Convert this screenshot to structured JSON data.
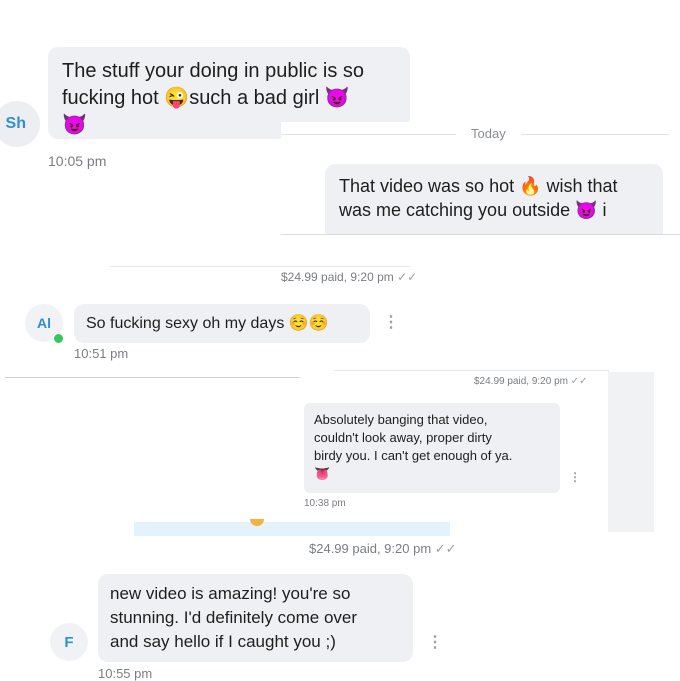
{
  "chat1": {
    "avatar": "Sh",
    "message": "The stuff your doing in public is so\nfucking hot 😜such a bad girl 😈\n😈",
    "time": "10:05 pm",
    "divider_label": "Today",
    "outgoing": "That video was so hot 🔥 wish that\nwas me catching you outside 😈 i",
    "paid": "$24.99 paid, 9:20 pm"
  },
  "chat2": {
    "avatar": "Al",
    "online_color": "#34c759",
    "message": "So fucking sexy oh my days ☺️☺️",
    "time": "10:51 pm",
    "paid_top": "$24.99 paid, 9:20 pm",
    "reply": "Absolutely banging that video,\ncouldn't look away, proper dirty\nbirdy you. I can't get enough of ya.\n👅",
    "reply_time": "10:38 pm",
    "paid_bottom": "$24.99 paid, 9:20 pm"
  },
  "chat3": {
    "avatar": "F",
    "message": "new video is amazing! you're so\nstunning. I'd definitely come over\nand say hello if I caught you ;)",
    "time": "10:55 pm"
  },
  "icons": {
    "kebab": "⋮",
    "double_check": "✓✓"
  }
}
